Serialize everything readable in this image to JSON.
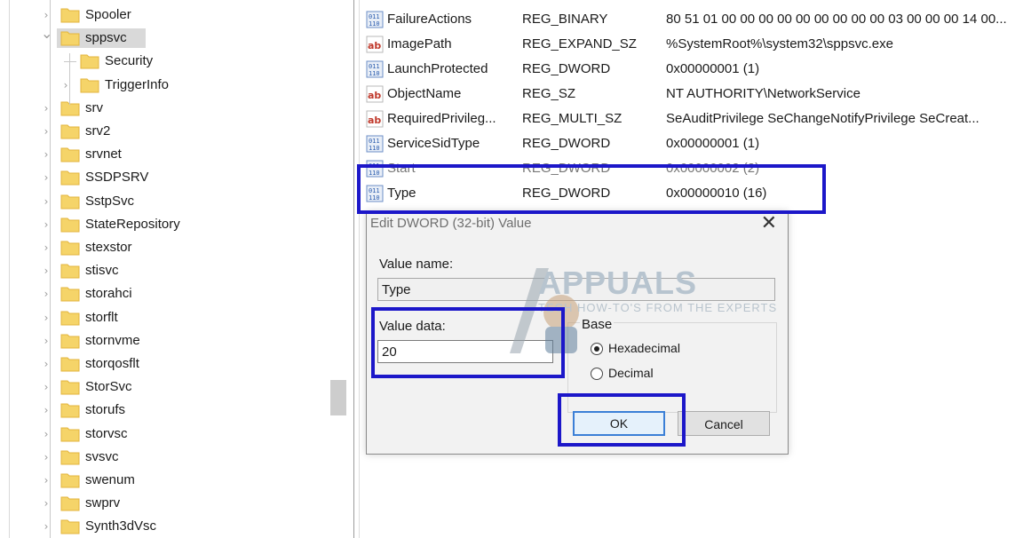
{
  "tree": {
    "items": [
      {
        "label": "Spooler",
        "expanded": false
      },
      {
        "label": "sppsvc",
        "expanded": true,
        "selected": true
      },
      {
        "label": "Security",
        "child": true,
        "has_children": false
      },
      {
        "label": "TriggerInfo",
        "child": true,
        "has_children": true
      },
      {
        "label": "srv"
      },
      {
        "label": "srv2"
      },
      {
        "label": "srvnet"
      },
      {
        "label": "SSDPSRV"
      },
      {
        "label": "SstpSvc"
      },
      {
        "label": "StateRepository"
      },
      {
        "label": "stexstor"
      },
      {
        "label": "stisvc"
      },
      {
        "label": "storahci"
      },
      {
        "label": "storflt"
      },
      {
        "label": "stornvme"
      },
      {
        "label": "storqosflt"
      },
      {
        "label": "StorSvc"
      },
      {
        "label": "storufs"
      },
      {
        "label": "storvsc"
      },
      {
        "label": "svsvc"
      },
      {
        "label": "swenum"
      },
      {
        "label": "swprv"
      },
      {
        "label": "Synth3dVsc"
      }
    ]
  },
  "values": [
    {
      "name": "FailureActions",
      "type": "REG_BINARY",
      "data": "80 51 01 00 00 00 00 00 00 00 00 00 03 00 00 00 14 00...",
      "icon": "binary-value-icon"
    },
    {
      "name": "ImagePath",
      "type": "REG_EXPAND_SZ",
      "data": "%SystemRoot%\\system32\\sppsvc.exe",
      "icon": "string-value-icon"
    },
    {
      "name": "LaunchProtected",
      "type": "REG_DWORD",
      "data": "0x00000001 (1)",
      "icon": "binary-value-icon"
    },
    {
      "name": "ObjectName",
      "type": "REG_SZ",
      "data": "NT AUTHORITY\\NetworkService",
      "icon": "string-value-icon"
    },
    {
      "name": "RequiredPrivileg...",
      "type": "REG_MULTI_SZ",
      "data": "SeAuditPrivilege SeChangeNotifyPrivilege SeCreat...",
      "icon": "string-value-icon"
    },
    {
      "name": "ServiceSidType",
      "type": "REG_DWORD",
      "data": "0x00000001 (1)",
      "icon": "binary-value-icon"
    },
    {
      "name": "Start",
      "type": "REG_DWORD",
      "data": "0x00000002 (2)",
      "icon": "binary-value-icon"
    },
    {
      "name": "Type",
      "type": "REG_DWORD",
      "data": "0x00000010 (16)",
      "icon": "binary-value-icon"
    }
  ],
  "dialog": {
    "title": "Edit DWORD (32-bit) Value",
    "close": "✕",
    "value_name_label": "Value name:",
    "value_name": "Type",
    "value_data_label": "Value data:",
    "value_data": "20",
    "base_label": "Base",
    "hex_label": "Hexadecimal",
    "dec_label": "Decimal",
    "base_selected": "Hexadecimal",
    "ok_label": "OK",
    "cancel_label": "Cancel"
  },
  "watermark": {
    "name": "APPUALS",
    "tagline": "TECH HOW-TO'S FROM THE EXPERTS"
  },
  "colors": {
    "highlight": "#1c17c9",
    "folder": "#f5d469",
    "folder_dark": "#e3b53d"
  }
}
